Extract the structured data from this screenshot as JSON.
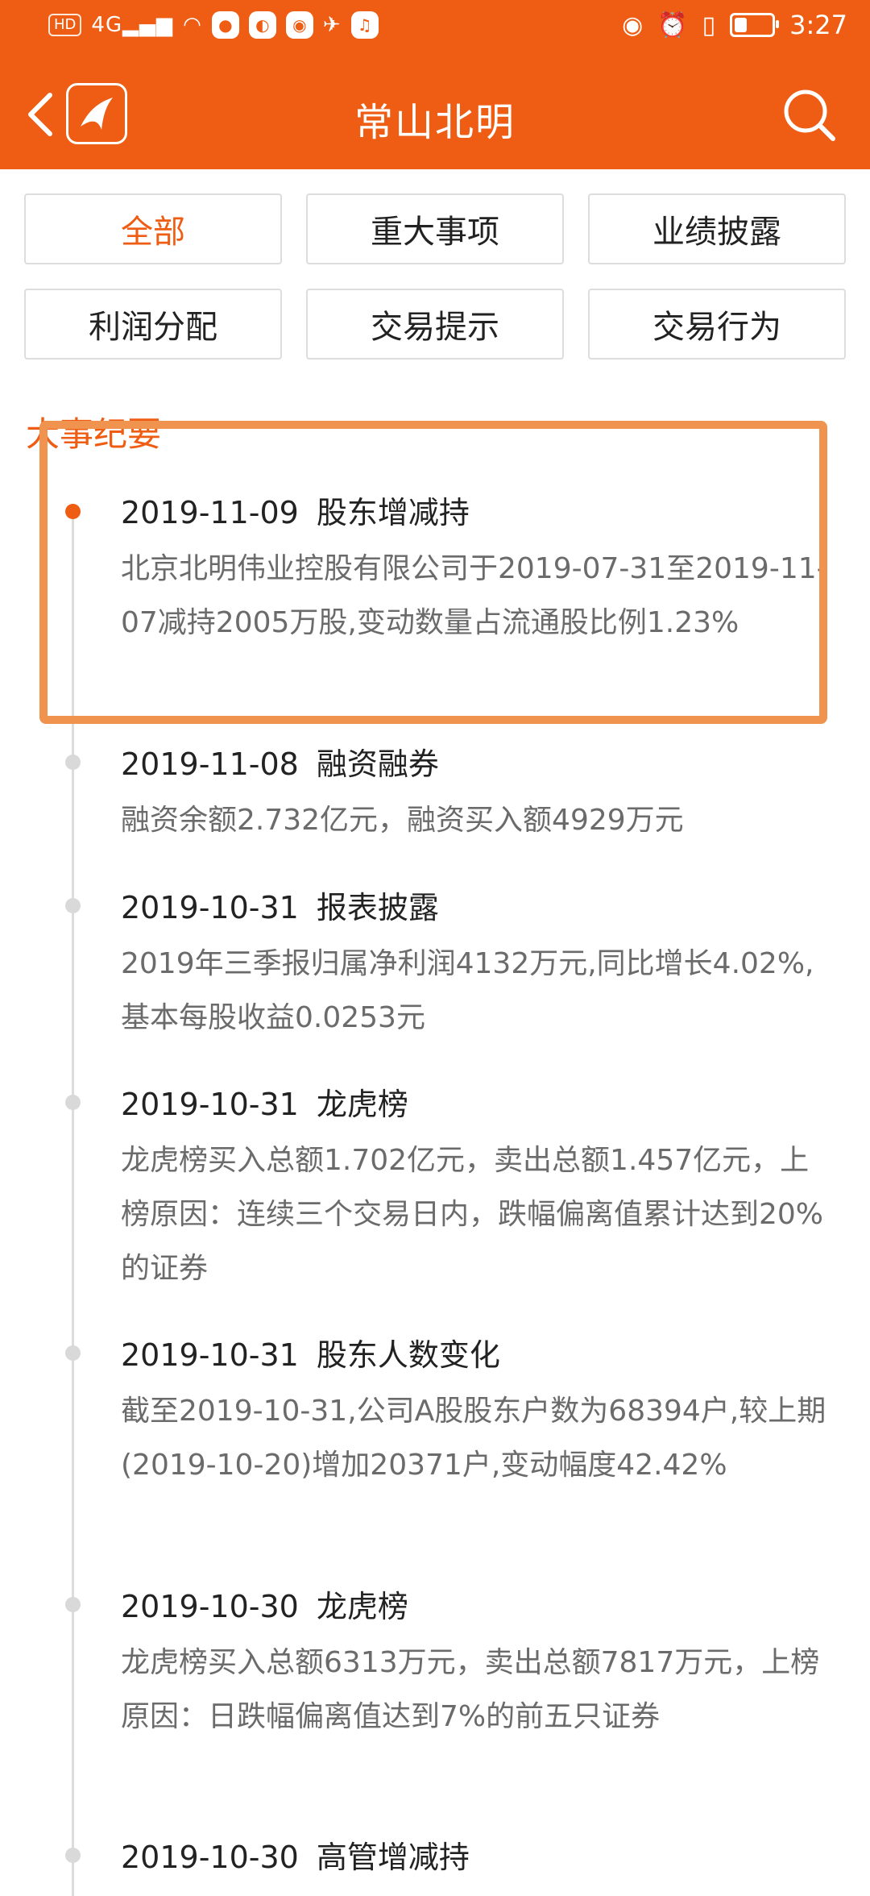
{
  "status_bar": {
    "hd": "HD",
    "network": "4G",
    "time": "3:27",
    "battery_level": 0.35
  },
  "header": {
    "title": "常山北明"
  },
  "filters": [
    "全部",
    "重大事项",
    "业绩披露",
    "利润分配",
    "交易提示",
    "交易行为"
  ],
  "active_filter": "全部",
  "section_title": "大事纪要",
  "events": [
    {
      "date": "2019-11-09",
      "type": "股东增减持",
      "detail": "北京北明伟业控股有限公司于2019-07-31至2019-11-07减持2005万股,变动数量占流通股比例1.23%"
    },
    {
      "date": "2019-11-08",
      "type": "融资融券",
      "detail": "融资余额2.732亿元，融资买入额4929万元"
    },
    {
      "date": "2019-10-31",
      "type": "报表披露",
      "detail": "2019年三季报归属净利润4132万元,同比增长4.02%,基本每股收益0.0253元"
    },
    {
      "date": "2019-10-31",
      "type": "龙虎榜",
      "detail": "龙虎榜买入总额1.702亿元，卖出总额1.457亿元，上榜原因：连续三个交易日内，跌幅偏离值累计达到20%的证券"
    },
    {
      "date": "2019-10-31",
      "type": "股东人数变化",
      "detail": "截至2019-10-31,公司A股股东户数为68394户,较上期(2019-10-20)增加20371户,变动幅度42.42%"
    },
    {
      "date": "2019-10-30",
      "type": "龙虎榜",
      "detail": "龙虎榜买入总额6313万元，卖出总额7817万元，上榜原因：日跌幅偏离值达到7%的前五只证券"
    },
    {
      "date": "2019-10-30",
      "type": "高管增减持",
      "detail": ""
    }
  ]
}
